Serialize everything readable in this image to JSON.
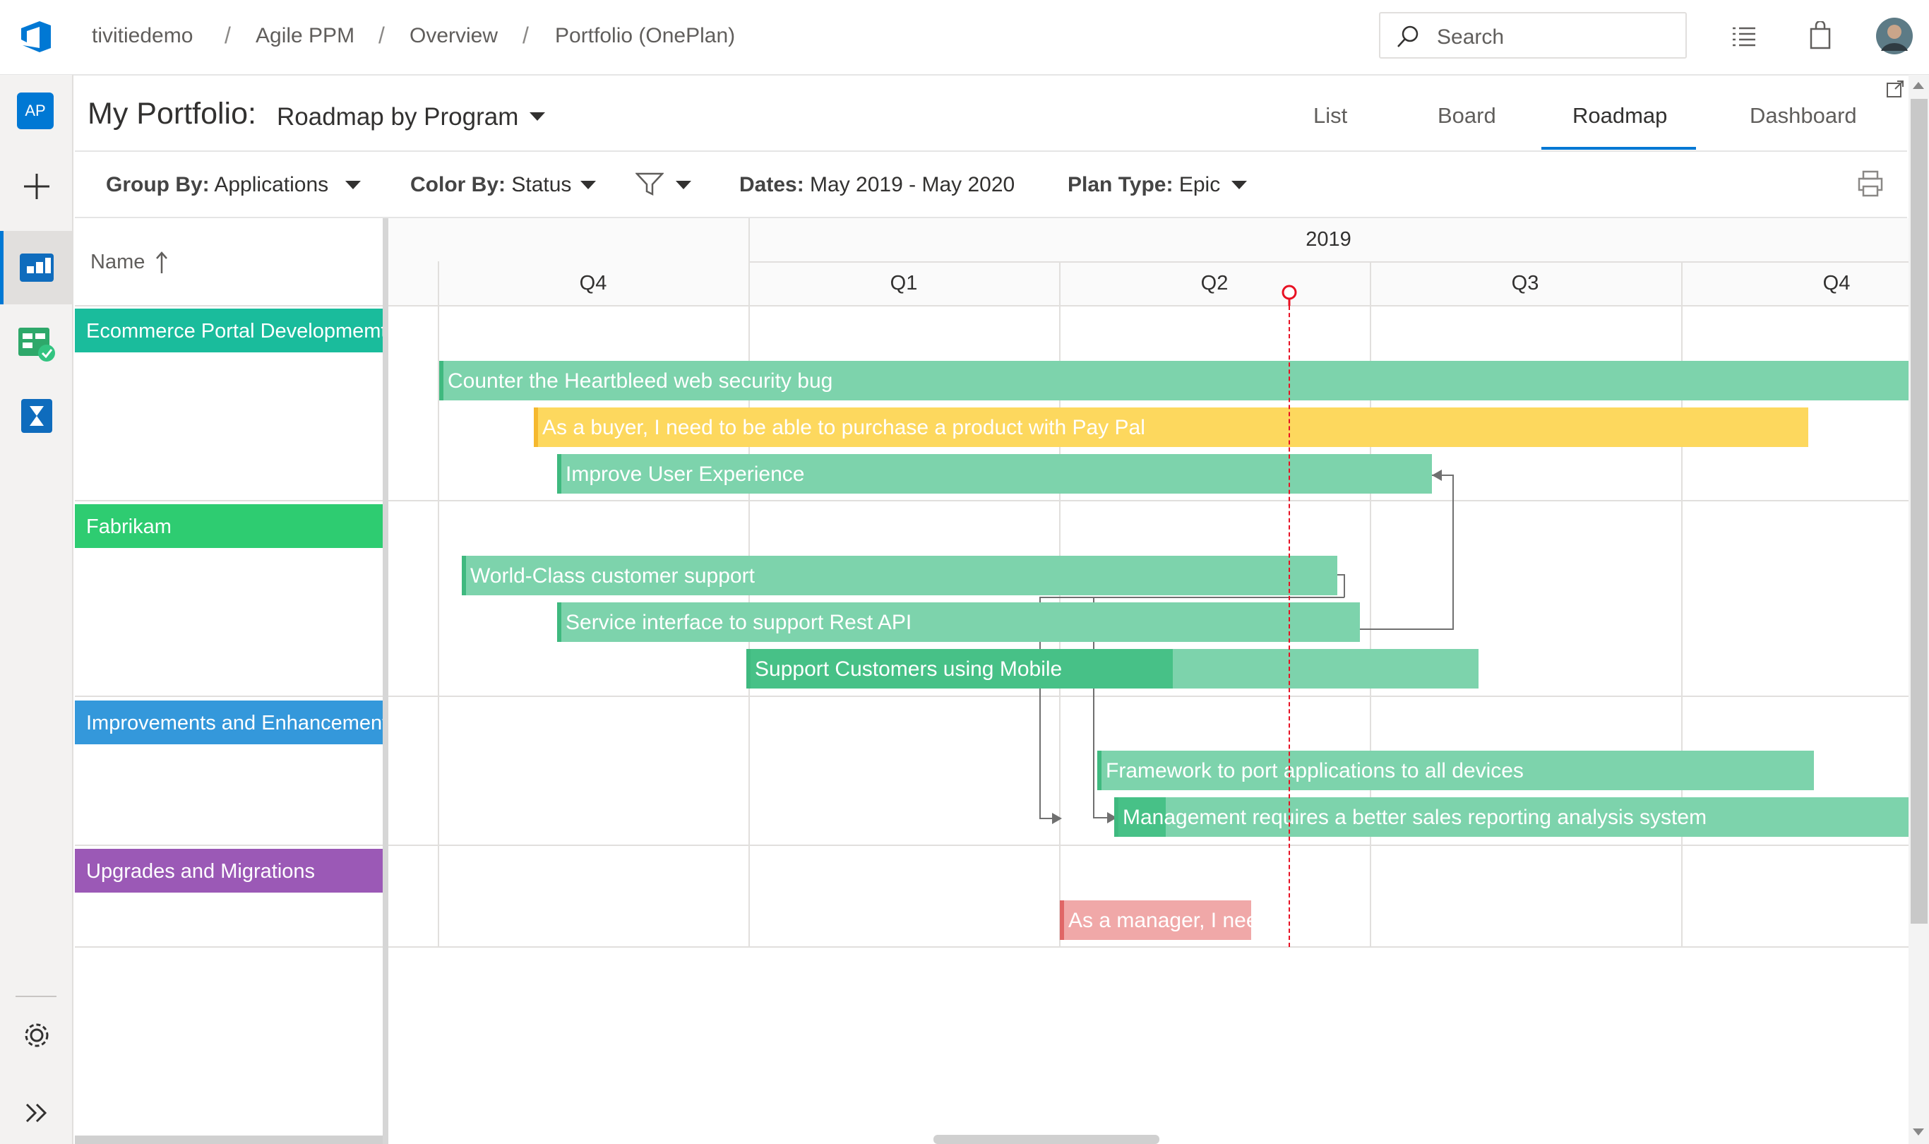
{
  "breadcrumb": [
    "tivitiedemo",
    "Agile PPM",
    "Overview",
    "Portfolio (OnePlan)"
  ],
  "breadcrumb_separator": "/",
  "search": {
    "placeholder": "Search"
  },
  "left_rail": {
    "badge": "AP"
  },
  "header": {
    "title": "My Portfolio:",
    "view_name": "Roadmap by Program"
  },
  "tabs": [
    "List",
    "Board",
    "Roadmap",
    "Dashboard"
  ],
  "active_tab": "Roadmap",
  "toolbar": {
    "group_by_label": "Group By:",
    "group_by_value": "Applications",
    "color_by_label": "Color By:",
    "color_by_value": "Status",
    "dates_label": "Dates:",
    "dates_value": "May 2019 - May 2020",
    "plan_type_label": "Plan Type:",
    "plan_type_value": "Epic"
  },
  "grid": {
    "name_header": "Name"
  },
  "timeline": {
    "year": "2019",
    "quarters": [
      "Q4",
      "Q1",
      "Q2",
      "Q3",
      "Q4"
    ]
  },
  "groups": [
    {
      "label": "Ecommerce Portal Developmemt",
      "color": "#1abc9c"
    },
    {
      "label": "Fabrikam",
      "color": "#2ecc71"
    },
    {
      "label": "Improvements and Enhancements",
      "color": "#3498db"
    },
    {
      "label": "Upgrades and Migrations",
      "color": "#9b59b6"
    }
  ],
  "items": [
    {
      "label": "Counter the Heartbleed web security bug",
      "status": "green",
      "progress": 0
    },
    {
      "label": "As a buyer, I need to be able to purchase a product with Pay Pal",
      "status": "yellow",
      "progress": 0
    },
    {
      "label": "Improve User Experience",
      "status": "green",
      "progress": 0
    },
    {
      "label": "World-Class customer support",
      "status": "green",
      "progress": 0
    },
    {
      "label": "Service interface to support Rest API",
      "status": "green",
      "progress": 0
    },
    {
      "label": "Support Customers using Mobile",
      "status": "green",
      "progress": 0.58
    },
    {
      "label": "Framework to port applications to all devices",
      "status": "green",
      "progress": 0
    },
    {
      "label": "Management requires a better sales reporting analysis system",
      "status": "green",
      "progress": 0.06
    },
    {
      "label": "As a manager, I nee",
      "status": "red",
      "progress": 0
    }
  ],
  "colors": {
    "green": "#7dd3ac",
    "green_progress": "#47c187",
    "green_edge": "#3fb97f",
    "yellow": "#fdd85e",
    "yellow_edge": "#f5b82e",
    "red": "#f0a8a8",
    "red_edge": "#e06666",
    "today_line": "#e81123",
    "accent": "#0078d4"
  }
}
